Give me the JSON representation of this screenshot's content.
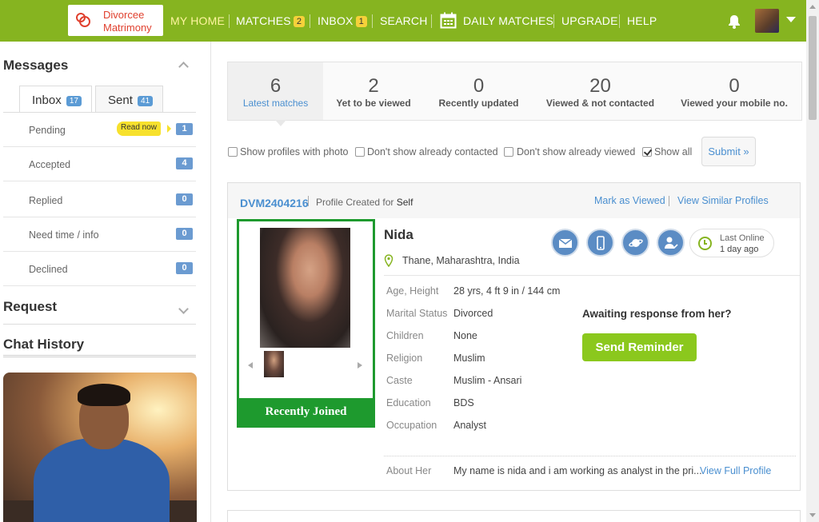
{
  "brand": {
    "line1": "Divorcee",
    "line2": "Matrimony",
    "primary_color": "#86b420"
  },
  "nav": {
    "my_home": "MY HOME",
    "matches": "MATCHES",
    "matches_count": "2",
    "inbox": "INBOX",
    "inbox_count": "1",
    "search": "SEARCH",
    "daily_matches": "DAILY MATCHES",
    "upgrade": "UPGRADE",
    "help": "HELP",
    "icons": [
      "calendar-icon",
      "bell-icon",
      "caret-down-icon"
    ]
  },
  "sidebar": {
    "messages_title": "Messages",
    "tabs": [
      {
        "label": "Inbox",
        "count": "17"
      },
      {
        "label": "Sent",
        "count": "41"
      }
    ],
    "rows": [
      {
        "label": "Pending",
        "count": "1",
        "tag": "Read now"
      },
      {
        "label": "Accepted",
        "count": "4"
      },
      {
        "label": "Replied",
        "count": "0"
      },
      {
        "label": "Need time / info",
        "count": "0"
      },
      {
        "label": "Declined",
        "count": "0"
      }
    ],
    "request_title": "Request",
    "chat_title": "Chat History"
  },
  "stats": [
    {
      "num": "6",
      "label": "Latest matches"
    },
    {
      "num": "2",
      "label": "Yet to be viewed"
    },
    {
      "num": "0",
      "label": "Recently updated"
    },
    {
      "num": "20",
      "label": "Viewed & not contacted"
    },
    {
      "num": "0",
      "label": "Viewed your mobile no."
    }
  ],
  "filters": {
    "with_photo": "Show profiles with photo",
    "not_contacted": "Don't show already contacted",
    "not_viewed": "Don't show already viewed",
    "show_all": "Show all",
    "submit": "Submit »"
  },
  "profile": {
    "id": "DVM2404216",
    "created_prefix": "Profile Created for",
    "created_for": "Self",
    "mark_viewed": "Mark as Viewed",
    "view_similar": "View Similar Profiles",
    "badge": "Recently Joined",
    "name": "Nida",
    "location": "Thane, Maharashtra, India",
    "last_online_label": "Last Online",
    "last_online_value": "1 day ago",
    "details": [
      {
        "label": "Age, Height",
        "value": "28 yrs, 4 ft 9 in / 144 cm"
      },
      {
        "label": "Marital Status",
        "value": "Divorced"
      },
      {
        "label": "Children",
        "value": "None"
      },
      {
        "label": "Religion",
        "value": "Muslim"
      },
      {
        "label": "Caste",
        "value": "Muslim - Ansari"
      },
      {
        "label": "Education",
        "value": "BDS"
      },
      {
        "label": "Occupation",
        "value": "Analyst"
      }
    ],
    "awaiting": "Awaiting response from her?",
    "send_reminder": "Send Reminder",
    "about_label": "About Her",
    "about_value": "My name is nida and i am working as analyst in the pri...",
    "view_full": "View Full Profile",
    "action_icons": [
      "mail-icon",
      "mobile-icon",
      "planet-icon",
      "verified-user-icon",
      "clock-icon"
    ]
  }
}
